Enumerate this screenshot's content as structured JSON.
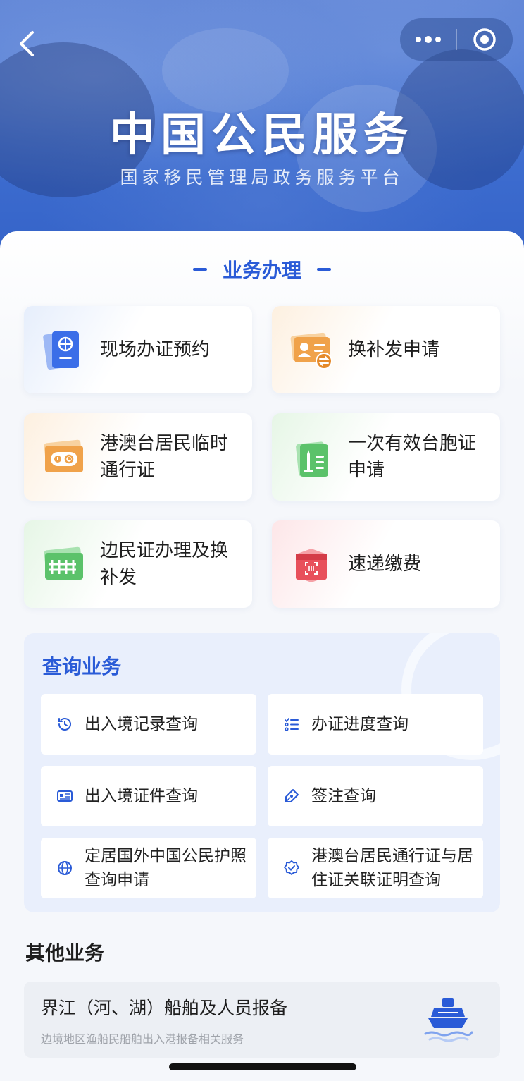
{
  "header": {
    "title": "中国公民服务",
    "subtitle": "国家移民管理局政务服务平台",
    "icons": [
      "back-icon",
      "more-icon",
      "close-circle-icon"
    ]
  },
  "business": {
    "title": "业务办理",
    "items": [
      {
        "label": "现场办证预约",
        "icon": "passport-icon",
        "theme": "blue"
      },
      {
        "label": "换补发申请",
        "icon": "id-card-exchange-icon",
        "theme": "orange"
      },
      {
        "label": "港澳台居民临时通行证",
        "icon": "temporary-pass-icon",
        "theme": "orange"
      },
      {
        "label": "一次有效台胞证申请",
        "icon": "taiwan-compatriot-permit-icon",
        "theme": "green"
      },
      {
        "label": "边民证办理及换补发",
        "icon": "border-resident-card-icon",
        "theme": "green"
      },
      {
        "label": "速递缴费",
        "icon": "express-package-icon",
        "theme": "red"
      }
    ]
  },
  "query": {
    "title": "查询业务",
    "items": [
      {
        "label": "出入境记录查询",
        "icon": "clock-history-icon"
      },
      {
        "label": "办证进度查询",
        "icon": "progress-list-icon"
      },
      {
        "label": "出入境证件查询",
        "icon": "id-document-icon"
      },
      {
        "label": "签注查询",
        "icon": "endorsement-pen-icon"
      },
      {
        "label": "定居国外中国公民护照查询申请",
        "icon": "globe-icon"
      },
      {
        "label": "港澳台居民通行证与居住证关联证明查询",
        "icon": "verified-badge-icon"
      }
    ]
  },
  "other": {
    "title": "其他业务",
    "card": {
      "title": "界江（河、湖）船舶及人员报备",
      "subtitle": "边境地区渔船民船舶出入港报备相关服务",
      "icon": "ship-icon"
    }
  },
  "colors": {
    "primary": "#2a5bd7",
    "orange": "#f0a24a",
    "green": "#5bc26a",
    "red": "#e8505b"
  }
}
